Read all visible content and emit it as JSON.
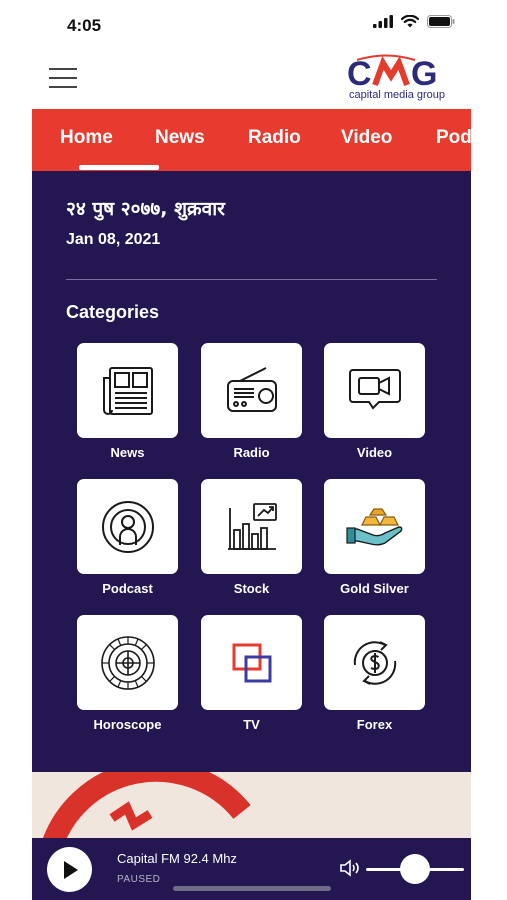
{
  "status_bar": {
    "time": "4:05"
  },
  "header": {
    "logo": {
      "text": "CMG",
      "tagline": "capital media group"
    }
  },
  "tabs": [
    {
      "label": "Home",
      "active": true
    },
    {
      "label": "News",
      "active": false
    },
    {
      "label": "Radio",
      "active": false
    },
    {
      "label": "Video",
      "active": false
    },
    {
      "label": "Pod",
      "active": false
    }
  ],
  "dates": {
    "nepali": "२४ पुष २०७७, शुक्रवार",
    "english": "Jan 08, 2021"
  },
  "categories": {
    "title": "Categories",
    "items": [
      {
        "label": "News",
        "icon": "newspaper-icon"
      },
      {
        "label": "Radio",
        "icon": "radio-icon"
      },
      {
        "label": "Video",
        "icon": "video-camera-icon"
      },
      {
        "label": "Podcast",
        "icon": "podcast-icon"
      },
      {
        "label": "Stock",
        "icon": "stock-chart-icon"
      },
      {
        "label": "Gold Silver",
        "icon": "gold-bars-icon"
      },
      {
        "label": "Horoscope",
        "icon": "zodiac-wheel-icon"
      },
      {
        "label": "TV",
        "icon": "tv-icon"
      },
      {
        "label": "Forex",
        "icon": "currency-exchange-icon"
      }
    ]
  },
  "player": {
    "station": "Capital FM 92.4 Mhz",
    "status": "PAUSED",
    "volume": 0.5
  },
  "colors": {
    "primary": "#241651",
    "accent": "#e63b2e",
    "brand_blue": "#2c2a7a"
  }
}
